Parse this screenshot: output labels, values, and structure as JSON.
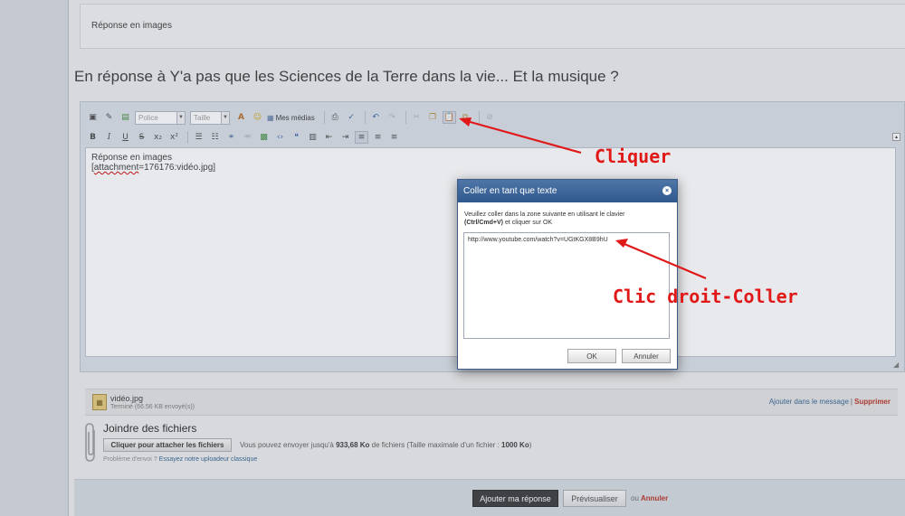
{
  "quote": {
    "text": "Réponse en images"
  },
  "reply_title": "En réponse à Y'a pas que les Sciences de la Terre dans la vie... Et la musique ?",
  "toolbar": {
    "font_placeholder": "Police",
    "size_placeholder": "Taille",
    "media_label": "Mes médias",
    "bold": "B",
    "italic": "I",
    "underline": "U",
    "strike": "S",
    "subscript": "x₂",
    "superscript": "x²"
  },
  "editor": {
    "line1": "Réponse en images",
    "line2_prefix": "[",
    "line2_word": "attachment",
    "line2_suffix": "=176176:vidéo.jpg]"
  },
  "attachment": {
    "file_name": "vidéo.jpg",
    "status": "Terminé (66.56 KB envoyé(s))",
    "insert_label": "Ajouter dans le message",
    "separator": "|",
    "delete_label": "Supprimer"
  },
  "join_files": {
    "title": "Joindre des fichiers",
    "button_label": "Cliquer pour attacher les fichiers",
    "quota_prefix": "Vous pouvez envoyer jusqu'à",
    "quota_value": "933,68 Ko",
    "quota_middle": "de fichiers (Taille maximale d'un fichier :",
    "quota_max": "1000 Ko",
    "quota_suffix": ")",
    "help_prefix": "Problème d'envoi ?",
    "help_link": "Essayez notre uploadeur classique"
  },
  "actions": {
    "submit_label": "Ajouter ma réponse",
    "preview_label": "Prévisualiser",
    "or_label": "ou",
    "cancel_label": "Annuler"
  },
  "dialog": {
    "title": "Coller en tant que texte",
    "close_label": "×",
    "instruction_line1": "Veuillez coller dans la zone suivante en utilisant le clavier",
    "instruction_keys": "(Ctrl/Cmd+V)",
    "instruction_line2": "et cliquer sur OK",
    "paste_value": "http://www.youtube.com/watch?v=UGtKGX8B9hU",
    "ok_label": "OK",
    "cancel_label": "Annuler"
  },
  "annotations": {
    "click": "Cliquer",
    "right_click_paste": "Clic droit-Coller"
  },
  "colors": {
    "dialog_header": "#3a6297",
    "annotation_red": "#e01818",
    "submit_button": "#333333",
    "delete_link": "#b52a1a"
  }
}
